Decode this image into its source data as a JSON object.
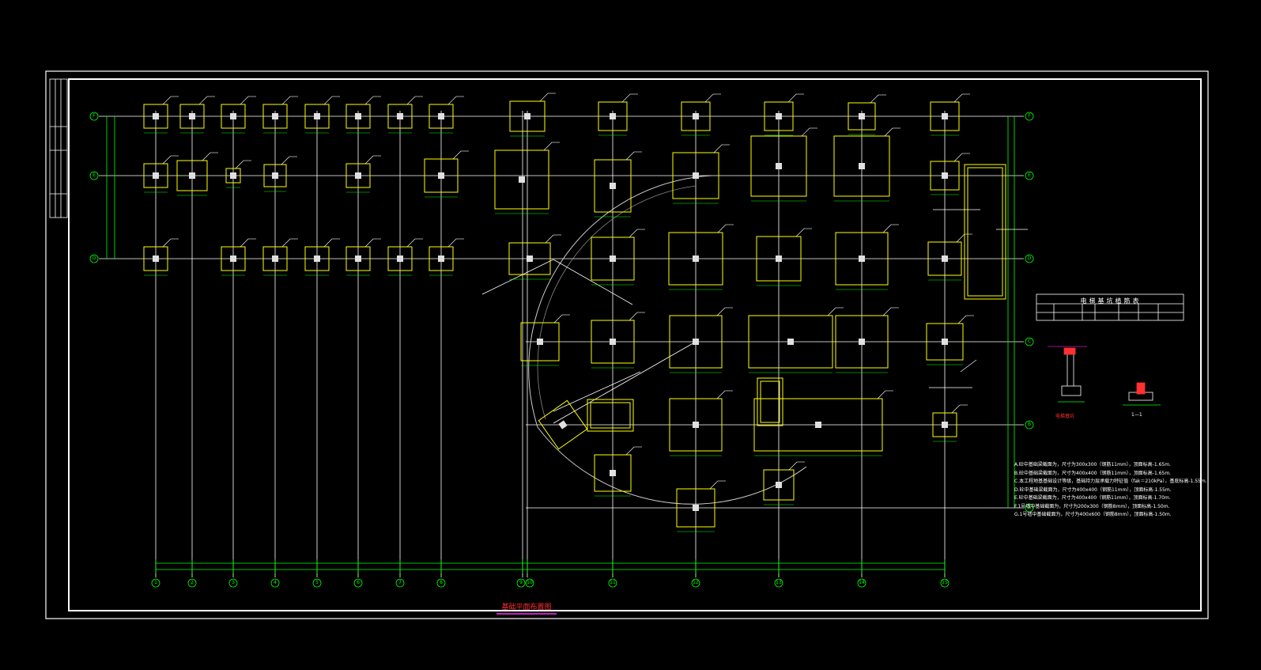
{
  "drawing": {
    "title": "基础平面布置图",
    "colors": {
      "background": "#000000",
      "frame": "#ffffff",
      "axis_grid": "#ffffff",
      "dimension": "#00ff00",
      "footing": "#ffff00",
      "column": "#ffffff",
      "title_text": "#ff3030",
      "title_underline": "#c020c0"
    }
  },
  "column_axes": [
    "1",
    "2",
    "3",
    "4",
    "5",
    "6",
    "7",
    "8",
    "9",
    "10",
    "11",
    "12",
    "13",
    "14",
    "15"
  ],
  "row_axes": [
    "F",
    "E",
    "D",
    "C",
    "B",
    "A"
  ],
  "table": {
    "title": "电梯基坑植筋表"
  },
  "notes": [
    "A.砼中基础梁截面为，尺寸为300x300（钢筋11mm），顶面标高-1.65m.",
    "B.砼中基础梁截面为，尺寸为400x400（钢筋11mm），顶面标高-1.65m.",
    "C.本工程地基基础设计等级，基础持力层承载力特征值（fak＝210kPa），基底标高-1.55m.",
    "D.砼中基础梁截面为，尺寸为400x400（钢筋11mm），顶面标高-1.55m.",
    "E.砼中基础梁截面为，尺寸为400x400（钢筋11mm），顶面标高-1.70m.",
    "F.1号墙中基础截面为，尺寸为200x300（钢筋8mm），顶面标高-1.50m.",
    "G.1号墙中基础截面为，尺寸为400x600（钢筋8mm），顶面标高-1.50m."
  ],
  "details": {
    "left_caption": "电梯基坑",
    "right_caption": "1—1"
  }
}
